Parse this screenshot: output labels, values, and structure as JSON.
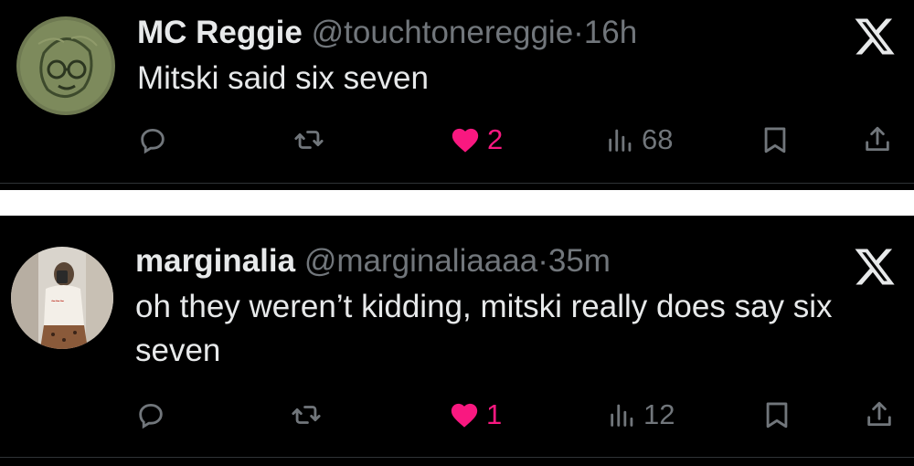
{
  "tweets": [
    {
      "display_name": "MC Reggie",
      "handle": "@touchtonereggie",
      "separator": "·",
      "time": "16h",
      "text": "Mitski said six seven",
      "metrics": {
        "replies": "",
        "retweets": "",
        "likes": "2",
        "views": "68"
      },
      "liked": true
    },
    {
      "display_name": "marginalia",
      "handle": "@marginaliaaaa",
      "separator": "·",
      "time": "35m",
      "text": "oh they weren’t kidding, mitski really does say six seven",
      "metrics": {
        "replies": "",
        "retweets": "",
        "likes": "1",
        "views": "12"
      },
      "liked": true
    }
  ],
  "icons": {
    "reply": "reply-icon",
    "retweet": "retweet-icon",
    "like": "heart-icon",
    "views": "views-icon",
    "bookmark": "bookmark-icon",
    "share": "share-icon",
    "brand": "x-logo-icon"
  },
  "colors": {
    "background": "#000000",
    "text_primary": "#e7e9ea",
    "text_secondary": "#71767b",
    "like_active": "#f91880",
    "separator_gap": "#ffffff"
  }
}
